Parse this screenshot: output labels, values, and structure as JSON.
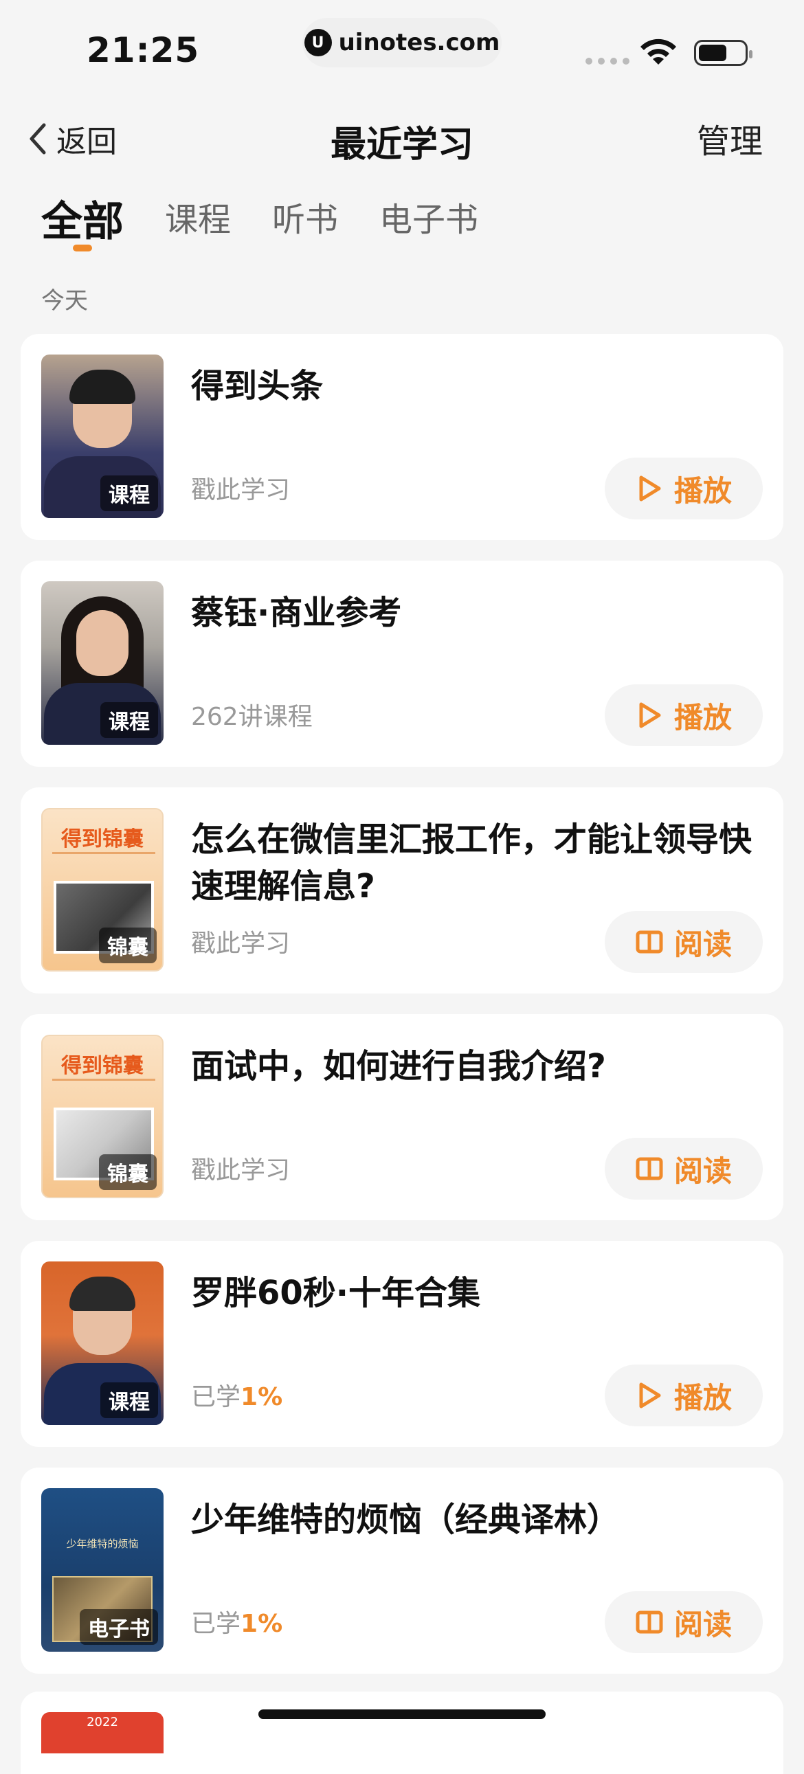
{
  "status_bar": {
    "time": "21:25",
    "url": "uinotes.com",
    "logo_letter": "U"
  },
  "nav": {
    "back_label": "返回",
    "title": "最近学习",
    "manage_label": "管理"
  },
  "tabs": [
    {
      "label": "全部",
      "active": true
    },
    {
      "label": "课程",
      "active": false
    },
    {
      "label": "听书",
      "active": false
    },
    {
      "label": "电子书",
      "active": false
    }
  ],
  "section_label": "今天",
  "accent_color": "#f08a2a",
  "items": [
    {
      "title": "得到头条",
      "subtitle": "戳此学习",
      "tag": "课程",
      "action_icon": "play-icon",
      "action_label": "播放"
    },
    {
      "title": "蔡钰·商业参考",
      "subtitle": "262讲课程",
      "tag": "课程",
      "action_icon": "play-icon",
      "action_label": "播放"
    },
    {
      "title": "怎么在微信里汇报工作，才能让领导快速理解信息?",
      "subtitle": "戳此学习",
      "tag": "锦囊",
      "cover_text": "得到锦囊",
      "action_icon": "book-icon",
      "action_label": "阅读"
    },
    {
      "title": "面试中，如何进行自我介绍?",
      "subtitle": "戳此学习",
      "tag": "锦囊",
      "cover_text": "得到锦囊",
      "action_icon": "book-icon",
      "action_label": "阅读"
    },
    {
      "title": "罗胖60秒·十年合集",
      "subtitle_prefix": "已学",
      "subtitle_value": "1%",
      "tag": "课程",
      "action_icon": "play-icon",
      "action_label": "播放"
    },
    {
      "title": "少年维特的烦恼（经典译林）",
      "subtitle_prefix": "已学",
      "subtitle_value": "1%",
      "tag": "电子书",
      "cover_text": "少年维特的烦恼",
      "action_icon": "book-icon",
      "action_label": "阅读"
    }
  ],
  "peek_item": {
    "cover_text": "2022"
  }
}
